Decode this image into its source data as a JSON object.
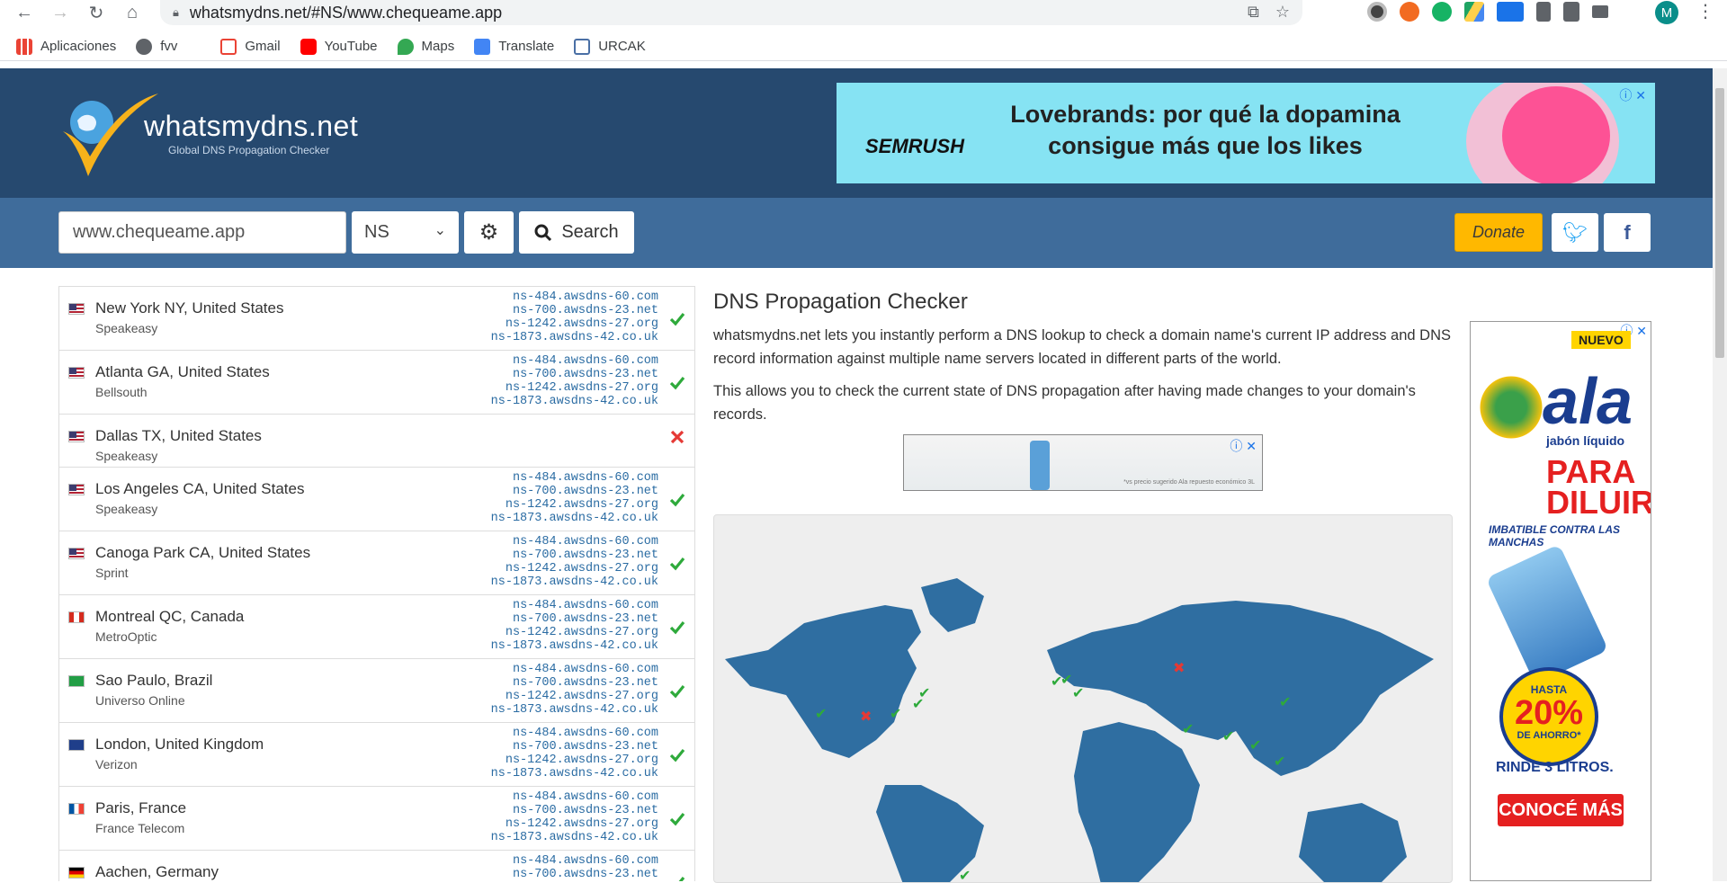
{
  "browser": {
    "url": "whatsmydns.net/#NS/www.chequeame.app",
    "avatar_letter": "M",
    "bookmarks": [
      {
        "label": "Aplicaciones",
        "icon": "apps-grid-icon"
      },
      {
        "label": "fvv",
        "icon": "globe-icon"
      },
      {
        "label": "Gmail",
        "icon": "gmail-icon"
      },
      {
        "label": "YouTube",
        "icon": "youtube-icon"
      },
      {
        "label": "Maps",
        "icon": "maps-icon"
      },
      {
        "label": "Translate",
        "icon": "translate-icon"
      },
      {
        "label": "URCAK",
        "icon": "drive-triangle-icon"
      }
    ]
  },
  "site": {
    "name": "whatsmydns.net",
    "tagline": "Global DNS Propagation Checker",
    "colors": {
      "header": "#26496f",
      "searchbar": "#3f6c9b",
      "donate": "#ffb800",
      "ok": "#2eaa3b",
      "fail": "#e53935",
      "map_land": "#2f6ea1"
    }
  },
  "top_ad": {
    "brand": "SEMRUSH",
    "headline": "Lovebrands: por qué la dopamina consigue más que los likes"
  },
  "search": {
    "domain": "www.chequeame.app",
    "record_type": "NS",
    "search_label": "Search",
    "donate_label": "Donate"
  },
  "ns_records": [
    "ns-484.awsdns-60.com",
    "ns-700.awsdns-23.net",
    "ns-1242.awsdns-27.org",
    "ns-1873.awsdns-42.co.uk"
  ],
  "results": [
    {
      "location": "New York NY, United States",
      "isp": "Speakeasy",
      "flag": "us",
      "status": "ok",
      "records": true
    },
    {
      "location": "Atlanta GA, United States",
      "isp": "Bellsouth",
      "flag": "us",
      "status": "ok",
      "records": true
    },
    {
      "location": "Dallas TX, United States",
      "isp": "Speakeasy",
      "flag": "us",
      "status": "fail",
      "records": false
    },
    {
      "location": "Los Angeles CA, United States",
      "isp": "Speakeasy",
      "flag": "us",
      "status": "ok",
      "records": true
    },
    {
      "location": "Canoga Park CA, United States",
      "isp": "Sprint",
      "flag": "us",
      "status": "ok",
      "records": true
    },
    {
      "location": "Montreal QC, Canada",
      "isp": "MetroOptic",
      "flag": "ca",
      "status": "ok",
      "records": true
    },
    {
      "location": "Sao Paulo, Brazil",
      "isp": "Universo Online",
      "flag": "br",
      "status": "ok",
      "records": true
    },
    {
      "location": "London, United Kingdom",
      "isp": "Verizon",
      "flag": "gb",
      "status": "ok",
      "records": true
    },
    {
      "location": "Paris, France",
      "isp": "France Telecom",
      "flag": "fr",
      "status": "ok",
      "records": true
    },
    {
      "location": "Aachen, Germany",
      "isp": "",
      "flag": "de",
      "status": "ok",
      "records": true
    }
  ],
  "main": {
    "title": "DNS Propagation Checker",
    "paragraph1": "whatsmydns.net lets you instantly perform a DNS lookup to check a domain name's current IP address and DNS record information against multiple name servers located in different parts of the world.",
    "paragraph2": "This allows you to check the current state of DNS propagation after having made changes to your domain's records."
  },
  "small_ad": {
    "fineprint": "*vs precio sugerido Ala repuesto económico 3L"
  },
  "side_ad": {
    "badge": "NUEVO",
    "brand": "ala",
    "subtitle": "jabón líquido",
    "headline": "PARA DILUIR",
    "claim": "IMBATIBLE CONTRA LAS MANCHAS",
    "hasta": "HASTA",
    "discount": "20%",
    "ahorro": "DE AHORRO*",
    "rinde": "RINDE 3 LITROS.",
    "cta": "CONOCÉ MÁS"
  }
}
